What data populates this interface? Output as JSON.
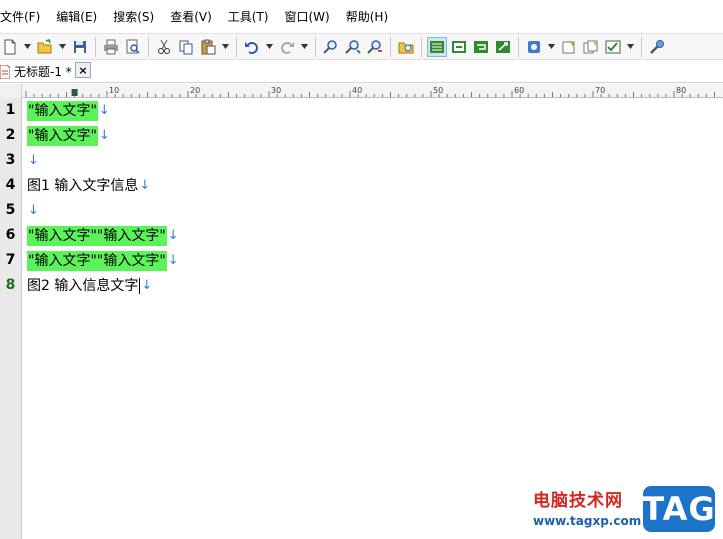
{
  "menu": [
    {
      "label": "文件(F)"
    },
    {
      "label": "编辑(E)"
    },
    {
      "label": "搜索(S)"
    },
    {
      "label": "查看(V)"
    },
    {
      "label": "工具(T)"
    },
    {
      "label": "窗口(W)"
    },
    {
      "label": "帮助(H)"
    }
  ],
  "toolbar_icons": [
    "new-document-icon",
    "open-folder-icon",
    "save-icon",
    "print-icon",
    "print-preview-icon",
    "cut-icon",
    "copy-icon",
    "paste-icon",
    "undo-icon",
    "redo-icon",
    "find-icon",
    "find-next-icon",
    "replace-icon",
    "find-in-files-icon",
    "word-wrap-icon",
    "hex-view-icon",
    "column-mode-icon",
    "ruler-icon",
    "ftp-icon",
    "macro-icon",
    "macro-play-icon",
    "settings-icon",
    "tools-icon"
  ],
  "tab": {
    "title": "无标题-1 *",
    "close_label": "×"
  },
  "ruler": {
    "labels": [
      "10",
      "20",
      "30",
      "40",
      "50",
      "60",
      "70",
      "80"
    ]
  },
  "lines": [
    {
      "num": "1",
      "segments": [
        {
          "text": "\"输入文字\"",
          "highlight": true
        }
      ],
      "eol": "↓"
    },
    {
      "num": "2",
      "segments": [
        {
          "text": "\"输入文字\"",
          "highlight": true
        }
      ],
      "eol": "↓"
    },
    {
      "num": "3",
      "segments": [],
      "eol": "↓"
    },
    {
      "num": "4",
      "segments": [
        {
          "text": "图1 输入文字信息",
          "highlight": false
        }
      ],
      "eol": "↓"
    },
    {
      "num": "5",
      "segments": [],
      "eol": "↓"
    },
    {
      "num": "6",
      "segments": [
        {
          "text": "\"输入文字\"\"输入文字\"",
          "highlight": true
        }
      ],
      "eol": "↓"
    },
    {
      "num": "7",
      "segments": [
        {
          "text": "\"输入文字\"\"输入文字\"",
          "highlight": true
        }
      ],
      "eol": "↓"
    },
    {
      "num": "8",
      "segments": [
        {
          "text": "图2 输入信息文字",
          "highlight": false
        }
      ],
      "eol": "↓",
      "current": true
    }
  ],
  "watermark": {
    "site_name": "电脑技术网",
    "url": "www.tagxp.com",
    "logo": "TAG"
  },
  "colors": {
    "highlight": "#5cf25a",
    "eol_marker": "#3a7bd5",
    "logo_bg": "#1b74c9",
    "site_name": "#d7261e"
  }
}
